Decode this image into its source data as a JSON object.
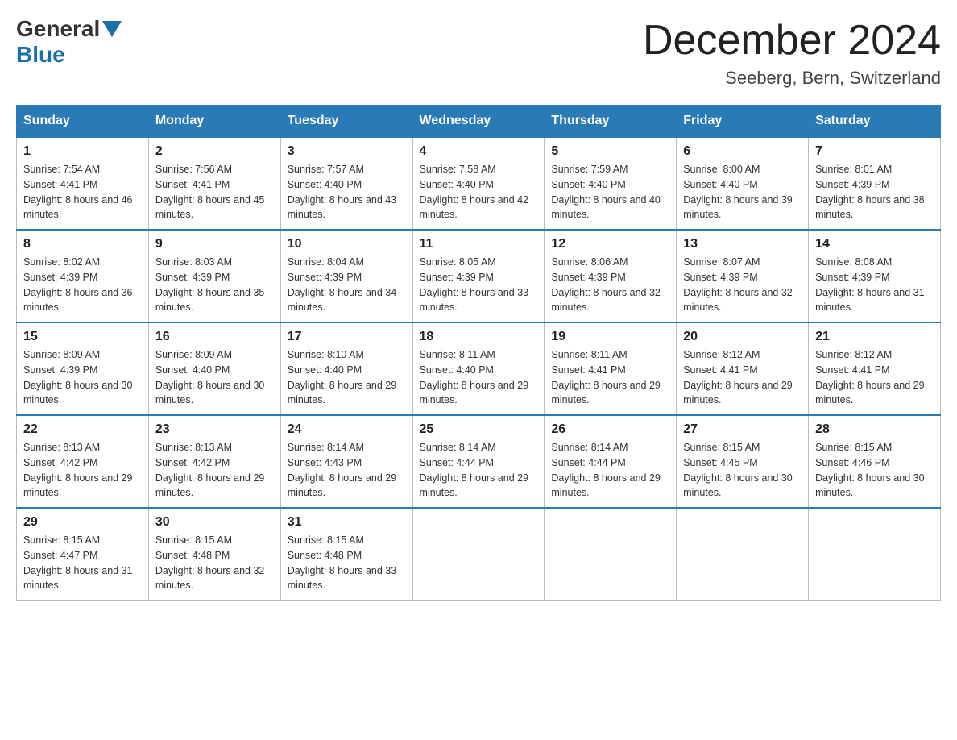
{
  "header": {
    "logo_general": "General",
    "logo_blue": "Blue",
    "title": "December 2024",
    "location": "Seeberg, Bern, Switzerland"
  },
  "days_of_week": [
    "Sunday",
    "Monday",
    "Tuesday",
    "Wednesday",
    "Thursday",
    "Friday",
    "Saturday"
  ],
  "weeks": [
    [
      {
        "day": "1",
        "sunrise": "7:54 AM",
        "sunset": "4:41 PM",
        "daylight": "8 hours and 46 minutes."
      },
      {
        "day": "2",
        "sunrise": "7:56 AM",
        "sunset": "4:41 PM",
        "daylight": "8 hours and 45 minutes."
      },
      {
        "day": "3",
        "sunrise": "7:57 AM",
        "sunset": "4:40 PM",
        "daylight": "8 hours and 43 minutes."
      },
      {
        "day": "4",
        "sunrise": "7:58 AM",
        "sunset": "4:40 PM",
        "daylight": "8 hours and 42 minutes."
      },
      {
        "day": "5",
        "sunrise": "7:59 AM",
        "sunset": "4:40 PM",
        "daylight": "8 hours and 40 minutes."
      },
      {
        "day": "6",
        "sunrise": "8:00 AM",
        "sunset": "4:40 PM",
        "daylight": "8 hours and 39 minutes."
      },
      {
        "day": "7",
        "sunrise": "8:01 AM",
        "sunset": "4:39 PM",
        "daylight": "8 hours and 38 minutes."
      }
    ],
    [
      {
        "day": "8",
        "sunrise": "8:02 AM",
        "sunset": "4:39 PM",
        "daylight": "8 hours and 36 minutes."
      },
      {
        "day": "9",
        "sunrise": "8:03 AM",
        "sunset": "4:39 PM",
        "daylight": "8 hours and 35 minutes."
      },
      {
        "day": "10",
        "sunrise": "8:04 AM",
        "sunset": "4:39 PM",
        "daylight": "8 hours and 34 minutes."
      },
      {
        "day": "11",
        "sunrise": "8:05 AM",
        "sunset": "4:39 PM",
        "daylight": "8 hours and 33 minutes."
      },
      {
        "day": "12",
        "sunrise": "8:06 AM",
        "sunset": "4:39 PM",
        "daylight": "8 hours and 32 minutes."
      },
      {
        "day": "13",
        "sunrise": "8:07 AM",
        "sunset": "4:39 PM",
        "daylight": "8 hours and 32 minutes."
      },
      {
        "day": "14",
        "sunrise": "8:08 AM",
        "sunset": "4:39 PM",
        "daylight": "8 hours and 31 minutes."
      }
    ],
    [
      {
        "day": "15",
        "sunrise": "8:09 AM",
        "sunset": "4:39 PM",
        "daylight": "8 hours and 30 minutes."
      },
      {
        "day": "16",
        "sunrise": "8:09 AM",
        "sunset": "4:40 PM",
        "daylight": "8 hours and 30 minutes."
      },
      {
        "day": "17",
        "sunrise": "8:10 AM",
        "sunset": "4:40 PM",
        "daylight": "8 hours and 29 minutes."
      },
      {
        "day": "18",
        "sunrise": "8:11 AM",
        "sunset": "4:40 PM",
        "daylight": "8 hours and 29 minutes."
      },
      {
        "day": "19",
        "sunrise": "8:11 AM",
        "sunset": "4:41 PM",
        "daylight": "8 hours and 29 minutes."
      },
      {
        "day": "20",
        "sunrise": "8:12 AM",
        "sunset": "4:41 PM",
        "daylight": "8 hours and 29 minutes."
      },
      {
        "day": "21",
        "sunrise": "8:12 AM",
        "sunset": "4:41 PM",
        "daylight": "8 hours and 29 minutes."
      }
    ],
    [
      {
        "day": "22",
        "sunrise": "8:13 AM",
        "sunset": "4:42 PM",
        "daylight": "8 hours and 29 minutes."
      },
      {
        "day": "23",
        "sunrise": "8:13 AM",
        "sunset": "4:42 PM",
        "daylight": "8 hours and 29 minutes."
      },
      {
        "day": "24",
        "sunrise": "8:14 AM",
        "sunset": "4:43 PM",
        "daylight": "8 hours and 29 minutes."
      },
      {
        "day": "25",
        "sunrise": "8:14 AM",
        "sunset": "4:44 PM",
        "daylight": "8 hours and 29 minutes."
      },
      {
        "day": "26",
        "sunrise": "8:14 AM",
        "sunset": "4:44 PM",
        "daylight": "8 hours and 29 minutes."
      },
      {
        "day": "27",
        "sunrise": "8:15 AM",
        "sunset": "4:45 PM",
        "daylight": "8 hours and 30 minutes."
      },
      {
        "day": "28",
        "sunrise": "8:15 AM",
        "sunset": "4:46 PM",
        "daylight": "8 hours and 30 minutes."
      }
    ],
    [
      {
        "day": "29",
        "sunrise": "8:15 AM",
        "sunset": "4:47 PM",
        "daylight": "8 hours and 31 minutes."
      },
      {
        "day": "30",
        "sunrise": "8:15 AM",
        "sunset": "4:48 PM",
        "daylight": "8 hours and 32 minutes."
      },
      {
        "day": "31",
        "sunrise": "8:15 AM",
        "sunset": "4:48 PM",
        "daylight": "8 hours and 33 minutes."
      },
      null,
      null,
      null,
      null
    ]
  ]
}
